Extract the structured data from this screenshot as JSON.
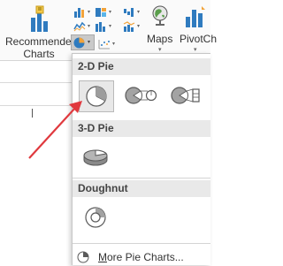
{
  "ribbon": {
    "recommended_line1": "Recommended",
    "recommended_line2": "Charts",
    "maps_label": "Maps",
    "pivot_label": "PivotCh"
  },
  "menu": {
    "section_2d": "2-D Pie",
    "section_3d": "3-D Pie",
    "section_doughnut": "Doughnut",
    "more_underlined": "M",
    "more_rest": "ore Pie Charts..."
  },
  "colors": {
    "accent": "#2f7bbf",
    "arrow": "#e0393e",
    "section_bg": "#e9e9e9"
  },
  "icons": [
    "recommended-charts-icon",
    "column-chart-icon",
    "line-chart-icon",
    "pie-chart-icon",
    "scatter-chart-icon",
    "maps-icon",
    "pivotchart-icon",
    "pie-icon",
    "pie-of-pie-icon",
    "bar-of-pie-icon",
    "3d-pie-icon",
    "doughnut-icon"
  ]
}
